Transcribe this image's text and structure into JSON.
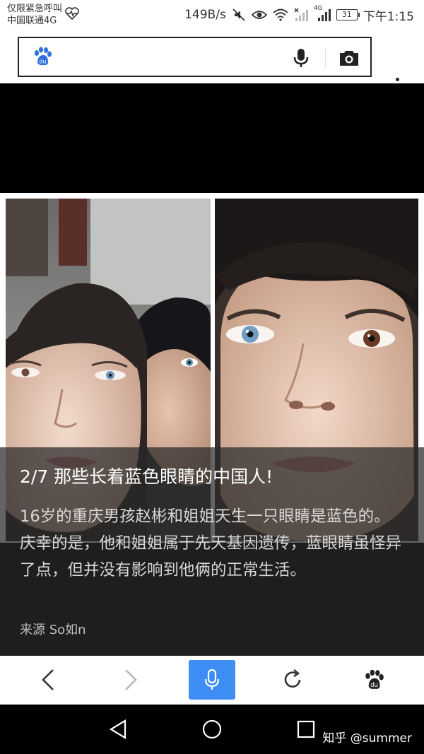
{
  "status_bar": {
    "carrier_line1": "仅限紧急呼叫",
    "carrier_line2": "中国联通4G",
    "network_speed": "149B/s",
    "signal_label": "4G",
    "battery_level": "31",
    "time": "下午1:15",
    "icons": [
      "heartbeat-icon",
      "mute-icon",
      "eye-icon",
      "wifi-icon",
      "signal-icon",
      "battery-icon"
    ]
  },
  "browser": {
    "search_placeholder": "",
    "logo_icon": "baidu-paw-icon",
    "voice_icon": "microphone-icon",
    "camera_icon": "camera-icon",
    "menu_icon": "more-vertical-icon"
  },
  "gallery": {
    "caption_title": "2/7 那些长着蓝色眼睛的中国人!",
    "caption_text": "16岁的重庆男孩赵彬和姐姐天生一只眼睛是蓝色的。庆幸的是，他和姐姐属于先天基因遗传，蓝眼睛虽怪异了点，但并没有影响到他俩的正常生活。",
    "source": "来源 So如n",
    "image_theme": "two photos of a brother and sister with one blue eye each"
  },
  "bottom_nav": {
    "items": [
      "back-icon",
      "forward-icon",
      "voice-search-icon",
      "refresh-icon",
      "baidu-home-icon"
    ],
    "accent": "#3d8df5"
  },
  "system_nav": {
    "items": [
      "back-triangle-icon",
      "home-circle-icon",
      "recents-square-icon"
    ]
  },
  "watermark": "知乎 @summer"
}
